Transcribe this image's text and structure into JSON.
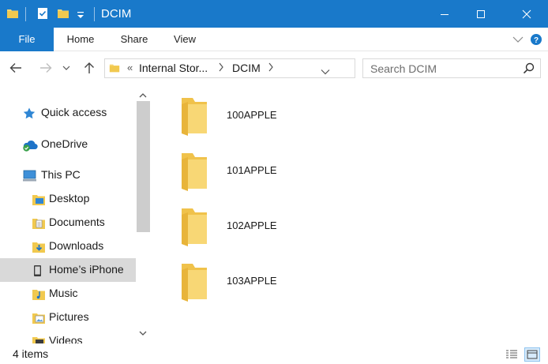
{
  "window": {
    "title": "DCIM",
    "accent_color": "#1979ca"
  },
  "ribbon": {
    "tabs": [
      {
        "label": "File"
      },
      {
        "label": "Home"
      },
      {
        "label": "Share"
      },
      {
        "label": "View"
      }
    ]
  },
  "address": {
    "overflow": "«",
    "crumbs": [
      {
        "label": "Internal Stor..."
      },
      {
        "label": "DCIM"
      }
    ]
  },
  "search": {
    "placeholder": "Search DCIM"
  },
  "navpane": {
    "items": [
      {
        "label": "Quick access",
        "icon": "star-icon"
      },
      {
        "label": "OneDrive",
        "icon": "cloud-icon"
      },
      {
        "label": "This PC",
        "icon": "computer-icon"
      },
      {
        "label": "Desktop",
        "icon": "desktop-folder-icon"
      },
      {
        "label": "Documents",
        "icon": "documents-folder-icon"
      },
      {
        "label": "Downloads",
        "icon": "downloads-folder-icon"
      },
      {
        "label": "Home’s iPhone",
        "icon": "phone-icon",
        "selected": true
      },
      {
        "label": "Music",
        "icon": "music-folder-icon"
      },
      {
        "label": "Pictures",
        "icon": "pictures-folder-icon"
      },
      {
        "label": "Videos",
        "icon": "videos-folder-icon"
      }
    ]
  },
  "content": {
    "folders": [
      {
        "name": "100APPLE"
      },
      {
        "name": "101APPLE"
      },
      {
        "name": "102APPLE"
      },
      {
        "name": "103APPLE"
      }
    ]
  },
  "status": {
    "item_count": "4 items"
  }
}
